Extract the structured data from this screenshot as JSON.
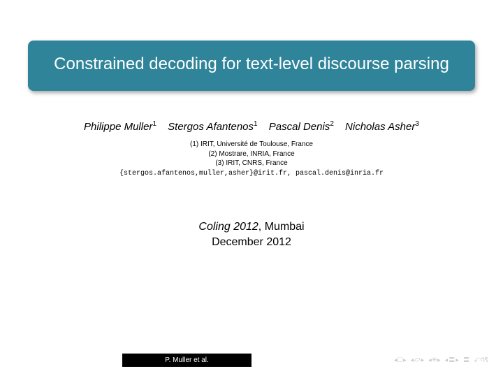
{
  "title": "Constrained decoding for text-level discourse parsing",
  "authors": [
    {
      "name": "Philippe Muller",
      "affil": "1"
    },
    {
      "name": "Stergos Afantenos",
      "affil": "1"
    },
    {
      "name": "Pascal Denis",
      "affil": "2"
    },
    {
      "name": "Nicholas Asher",
      "affil": "3"
    }
  ],
  "affiliations": [
    "(1) IRIT, Université de Toulouse, France",
    "(2) Mostrare, INRIA, France",
    "(3) IRIT, CNRS, France"
  ],
  "emails": "{stergos.afantenos,muller,asher}@irit.fr, pascal.denis@inria.fr",
  "venue": {
    "conference": "Coling 2012",
    "location": ", Mumbai",
    "date": "December 2012"
  },
  "footer_author": "P. Muller et al."
}
